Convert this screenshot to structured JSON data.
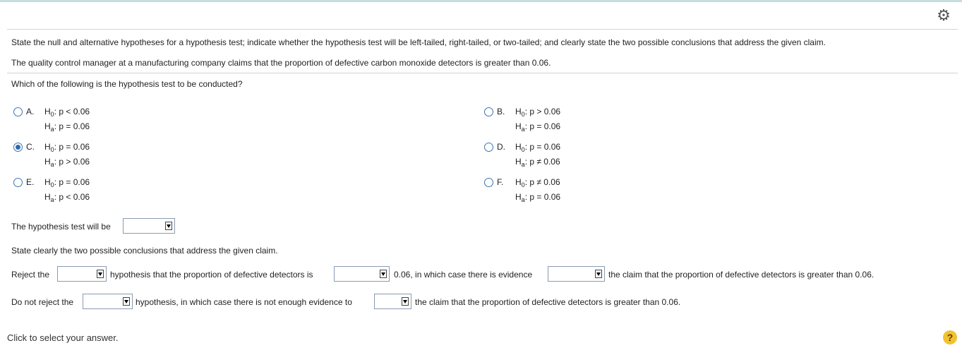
{
  "intro": "State the null and alternative hypotheses for a hypothesis test; indicate whether the hypothesis test will be left-tailed, right-tailed, or two-tailed; and clearly state the two possible conclusions that address the given claim.",
  "claim": "The quality control manager at a manufacturing company claims that the proportion of defective carbon monoxide detectors is greater than 0.06.",
  "question": "Which of the following is the hypothesis test to be conducted?",
  "options": [
    {
      "letter": "A.",
      "h0": "p < 0.06",
      "ha": "p = 0.06"
    },
    {
      "letter": "B.",
      "h0": "p > 0.06",
      "ha": "p = 0.06"
    },
    {
      "letter": "C.",
      "h0": "p = 0.06",
      "ha": "p > 0.06"
    },
    {
      "letter": "D.",
      "h0": "p = 0.06",
      "ha": "p ≠ 0.06"
    },
    {
      "letter": "E.",
      "h0": "p = 0.06",
      "ha": "p < 0.06"
    },
    {
      "letter": "F.",
      "h0": "p ≠ 0.06",
      "ha": "p = 0.06"
    }
  ],
  "selected_option": "C.",
  "symbols": {
    "H": "H",
    "sub0": "0",
    "suba": "a",
    "colon": ": "
  },
  "tail_prompt": "The hypothesis test will be",
  "conclusions_prompt": "State clearly the two possible conclusions that address the given claim.",
  "reject": {
    "t1": "Reject the",
    "t2": "hypothesis that the proportion of defective detectors is",
    "t3": "0.06, in which case there is evidence",
    "t4": "the claim that the proportion of defective detectors is greater than 0.06."
  },
  "not_reject": {
    "t1": "Do not reject the",
    "t2": "hypothesis, in which case there is not enough evidence to",
    "t3": "the claim that the proportion of defective detectors is greater than 0.06."
  },
  "footer": "Click to select your answer.",
  "help_label": "?",
  "icons": {
    "settings": "gear-icon",
    "help": "help-icon"
  },
  "colors": {
    "accent": "#2a6bb0",
    "topbar": "#c7dde0",
    "help": "#f2c230"
  }
}
